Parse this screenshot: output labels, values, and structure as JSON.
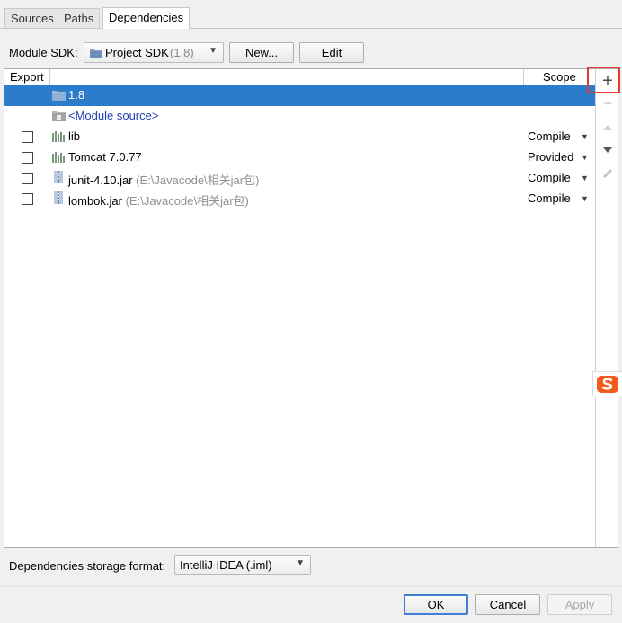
{
  "tabs": [
    {
      "label": "Sources"
    },
    {
      "label": "Paths"
    },
    {
      "label": "Dependencies"
    }
  ],
  "sdk": {
    "label": "Module SDK:",
    "value": "Project SDK",
    "version": "(1.8)",
    "new_button": "New...",
    "edit_button": "Edit"
  },
  "table": {
    "headers": {
      "export": "Export",
      "scope": "Scope"
    },
    "rows": [
      {
        "name": "1.8",
        "path": "",
        "scope": "",
        "checkbox": false,
        "icon": "folder-icon"
      },
      {
        "name": "<Module source>",
        "path": "",
        "scope": "",
        "checkbox": false,
        "icon": "folder-icon"
      },
      {
        "name": "lib",
        "path": "",
        "scope": "Compile",
        "checkbox": true,
        "icon": "library-icon"
      },
      {
        "name": "Tomcat 7.0.77",
        "path": "",
        "scope": "Provided",
        "checkbox": true,
        "icon": "library-icon"
      },
      {
        "name": "junit-4.10.jar",
        "path": "(E:\\Javacode\\相关jar包)",
        "scope": "Compile",
        "checkbox": true,
        "icon": "jar-icon"
      },
      {
        "name": "lombok.jar",
        "path": "(E:\\Javacode\\相关jar包)",
        "scope": "Compile",
        "checkbox": true,
        "icon": "jar-icon"
      }
    ]
  },
  "toolbar": {
    "add": "+",
    "remove": "−"
  },
  "storage": {
    "label": "Dependencies storage format:",
    "value": "IntelliJ IDEA (.iml)"
  },
  "buttons": {
    "ok": "OK",
    "cancel": "Cancel",
    "apply": "Apply"
  },
  "colors": {
    "selection": "#2c7ccc",
    "module_source": "#1f3fb5",
    "highlight": "#e23b30"
  }
}
